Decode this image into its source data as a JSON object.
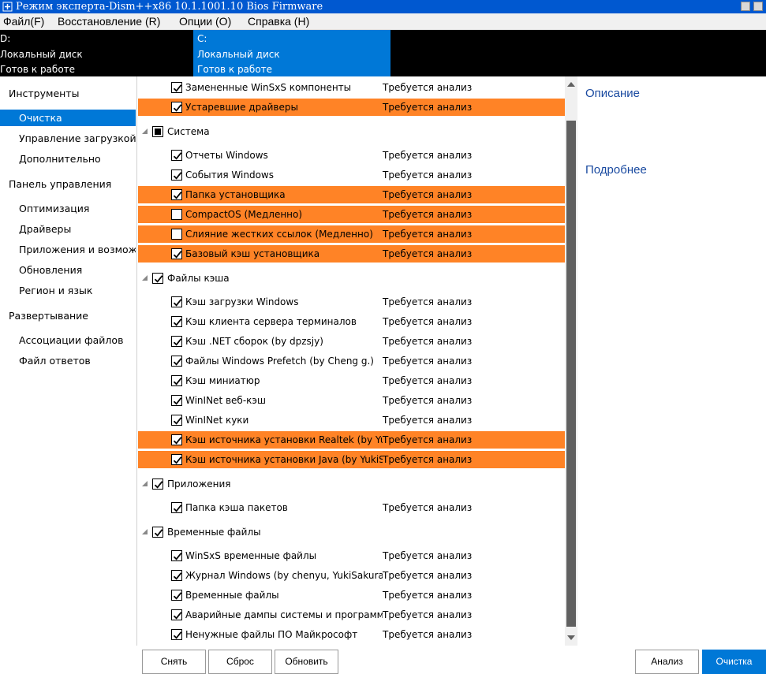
{
  "window": {
    "title": "Режим эксперта-Dism++x86 10.1.1001.10 Bios Firmware"
  },
  "menubar": {
    "items": [
      {
        "label": "Файл(F)"
      },
      {
        "label": "Восстановление (R)"
      },
      {
        "label": "Опции (O)"
      },
      {
        "label": "Справка (H)"
      }
    ]
  },
  "drives": [
    {
      "letter": "D:",
      "type": "Локальный диск",
      "status": "Готов к работе",
      "selected": false
    },
    {
      "letter": "C:",
      "type": "Локальный диск",
      "status": "Готов к работе",
      "selected": true
    }
  ],
  "sidebar": {
    "items": [
      {
        "label": "Инструменты",
        "kind": "category"
      },
      {
        "label": "Очистка",
        "kind": "sub",
        "selected": true
      },
      {
        "label": "Управление загрузкой",
        "kind": "sub"
      },
      {
        "label": "Дополнительно",
        "kind": "sub"
      },
      {
        "label": "Панель управления",
        "kind": "category"
      },
      {
        "label": "Оптимизация",
        "kind": "sub"
      },
      {
        "label": "Драйверы",
        "kind": "sub"
      },
      {
        "label": "Приложения и возможности",
        "kind": "sub"
      },
      {
        "label": "Обновления",
        "kind": "sub"
      },
      {
        "label": "Регион и язык",
        "kind": "sub"
      },
      {
        "label": "Развертывание",
        "kind": "category"
      },
      {
        "label": "Ассоциации файлов",
        "kind": "sub"
      },
      {
        "label": "Файл ответов",
        "kind": "sub"
      }
    ]
  },
  "cleanup": {
    "rows": [
      {
        "kind": "item",
        "label": "Замененные WinSxS компоненты",
        "status": "Требуется анализ",
        "checked": true,
        "highlight": false
      },
      {
        "kind": "item",
        "label": "Устаревшие драйверы",
        "status": "Требуется анализ",
        "checked": true,
        "highlight": true
      },
      {
        "kind": "group",
        "label": "Система",
        "state": "partial"
      },
      {
        "kind": "item",
        "label": "Отчеты Windows",
        "status": "Требуется анализ",
        "checked": true,
        "highlight": false
      },
      {
        "kind": "item",
        "label": "События Windows",
        "status": "Требуется анализ",
        "checked": true,
        "highlight": false
      },
      {
        "kind": "item",
        "label": "Папка установщика",
        "status": "Требуется анализ",
        "checked": true,
        "highlight": true
      },
      {
        "kind": "item",
        "label": "CompactOS (Медленно)",
        "status": "Требуется анализ",
        "checked": false,
        "highlight": true
      },
      {
        "kind": "item",
        "label": "Слияние жестких ссылок (Медленно)",
        "status": "Требуется анализ",
        "checked": false,
        "highlight": true
      },
      {
        "kind": "item",
        "label": "Базовый кэш установщика",
        "status": "Требуется анализ",
        "checked": true,
        "highlight": true
      },
      {
        "kind": "group",
        "label": "Файлы кэша",
        "state": "checked"
      },
      {
        "kind": "item",
        "label": "Кэш загрузки Windows",
        "status": "Требуется анализ",
        "checked": true,
        "highlight": false
      },
      {
        "kind": "item",
        "label": "Кэш клиента сервера терминалов",
        "status": "Требуется анализ",
        "checked": true,
        "highlight": false
      },
      {
        "kind": "item",
        "label": "Кэш .NET сборок (by dpzsjy)",
        "status": "Требуется анализ",
        "checked": true,
        "highlight": false
      },
      {
        "kind": "item",
        "label": "Файлы Windows Prefetch (by Cheng g.)",
        "status": "Требуется анализ",
        "checked": true,
        "highlight": false
      },
      {
        "kind": "item",
        "label": "Кэш миниатюр",
        "status": "Требуется анализ",
        "checked": true,
        "highlight": false
      },
      {
        "kind": "item",
        "label": "WinINet веб-кэш",
        "status": "Требуется анализ",
        "checked": true,
        "highlight": false
      },
      {
        "kind": "item",
        "label": "WinINet куки",
        "status": "Требуется анализ",
        "checked": true,
        "highlight": false
      },
      {
        "kind": "item",
        "label": "Кэш источника установки Realtek (by YukiSakura)",
        "status": "Требуется анализ",
        "checked": true,
        "highlight": true
      },
      {
        "kind": "item",
        "label": "Кэш источника установки Java (by YukiSakura)",
        "status": "Требуется анализ",
        "checked": true,
        "highlight": true
      },
      {
        "kind": "group",
        "label": "Приложения",
        "state": "checked"
      },
      {
        "kind": "item",
        "label": "Папка кэша пакетов",
        "status": "Требуется анализ",
        "checked": true,
        "highlight": false
      },
      {
        "kind": "group",
        "label": "Временные файлы",
        "state": "checked"
      },
      {
        "kind": "item",
        "label": "WinSxS временные файлы",
        "status": "Требуется анализ",
        "checked": true,
        "highlight": false
      },
      {
        "kind": "item",
        "label": "Журнал Windows (by chenyu, YukiSakura)",
        "status": "Требуется анализ",
        "checked": true,
        "highlight": false
      },
      {
        "kind": "item",
        "label": "Временные файлы",
        "status": "Требуется анализ",
        "checked": true,
        "highlight": false
      },
      {
        "kind": "item",
        "label": "Аварийные дампы системы и программ (by YukiSakura)",
        "status": "Требуется анализ",
        "checked": true,
        "highlight": false
      },
      {
        "kind": "item",
        "label": "Ненужные файлы ПО Майкрософт",
        "status": "Требуется анализ",
        "checked": true,
        "highlight": false
      }
    ]
  },
  "description": {
    "heading": "Описание",
    "details": "Подробнее"
  },
  "buttons": {
    "remove": "Снять",
    "reset": "Сброс",
    "refresh": "Обновить",
    "analyze": "Анализ",
    "clean": "Очистка"
  },
  "colors": {
    "accent": "#0078d7",
    "highlight": "#ff8326",
    "titlebar": "#0058d0"
  }
}
